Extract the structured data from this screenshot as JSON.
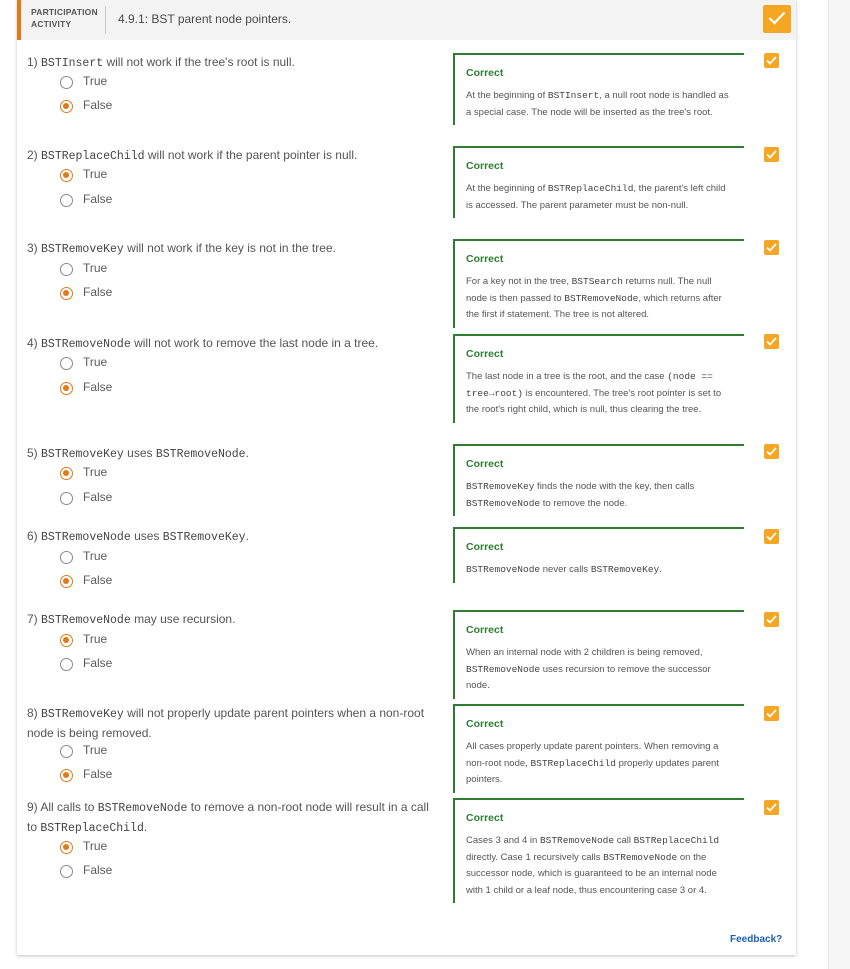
{
  "activity": {
    "label": "PARTICIPATION ACTIVITY",
    "title": "4.9.1: BST parent node pointers.",
    "complete_icon": "checkmark-icon",
    "feedback_link": "Feedback?"
  },
  "colors": {
    "accent": "#e07a17",
    "check": "#f5a623",
    "correct": "#2e7d32",
    "link": "#1a5fb4"
  },
  "questions": [
    {
      "number": "1)",
      "code": "BSTInsert",
      "text": " will not work if the tree's root is null.",
      "options": [
        "True",
        "False"
      ],
      "selected": "False",
      "status": "Correct",
      "feedback": [
        {
          "t": "At the beginning of "
        },
        {
          "c": "BSTInsert"
        },
        {
          "t": ", a null root node is handled as a special case. The node will be inserted as the tree's root."
        }
      ]
    },
    {
      "number": "2)",
      "code": "BSTReplaceChild",
      "text": " will not work if the parent pointer is null.",
      "options": [
        "True",
        "False"
      ],
      "selected": "True",
      "status": "Correct",
      "feedback": [
        {
          "t": "At the beginning of "
        },
        {
          "c": "BSTReplaceChild"
        },
        {
          "t": ", the parent's left child is accessed. The parent parameter must be non-null."
        }
      ]
    },
    {
      "number": "3)",
      "code": "BSTRemoveKey",
      "text": " will not work if the key is not in the tree.",
      "options": [
        "True",
        "False"
      ],
      "selected": "False",
      "status": "Correct",
      "feedback": [
        {
          "t": "For a key not in the tree, "
        },
        {
          "c": "BSTSearch"
        },
        {
          "t": " returns null. The null node is then passed to "
        },
        {
          "c": "BSTRemoveNode"
        },
        {
          "t": ", which returns after the first if statement. The tree is not altered."
        }
      ]
    },
    {
      "number": "4)",
      "code": "BSTRemoveNode",
      "text": " will not work to remove the last node in a tree.",
      "options": [
        "True",
        "False"
      ],
      "selected": "False",
      "status": "Correct",
      "feedback": [
        {
          "t": "The last node in a tree is the root, and the case "
        },
        {
          "c": "(node == tree→root)"
        },
        {
          "t": " is encountered. The tree's root pointer is set to the root's right child, which is null, thus clearing the tree."
        }
      ]
    },
    {
      "number": "5)",
      "code": "BSTRemoveKey",
      "text": " uses ",
      "code2": "BSTRemoveNode",
      "text2": ".",
      "options": [
        "True",
        "False"
      ],
      "selected": "True",
      "status": "Correct",
      "feedback": [
        {
          "c": "BSTRemoveKey"
        },
        {
          "t": " finds the node with the key, then calls "
        },
        {
          "c": "BSTRemoveNode"
        },
        {
          "t": " to remove the node."
        }
      ]
    },
    {
      "number": "6)",
      "code": "BSTRemoveNode",
      "text": " uses ",
      "code2": "BSTRemoveKey",
      "text2": ".",
      "options": [
        "True",
        "False"
      ],
      "selected": "False",
      "status": "Correct",
      "feedback": [
        {
          "c": "BSTRemoveNode"
        },
        {
          "t": " never calls "
        },
        {
          "c": "BSTRemoveKey"
        },
        {
          "t": "."
        }
      ]
    },
    {
      "number": "7)",
      "code": "BSTRemoveNode",
      "text": " may use recursion.",
      "options": [
        "True",
        "False"
      ],
      "selected": "True",
      "status": "Correct",
      "feedback": [
        {
          "t": "When an internal node with 2 children is being removed, "
        },
        {
          "c": "BSTRemoveNode"
        },
        {
          "t": " uses recursion to remove the successor node."
        }
      ]
    },
    {
      "number": "8)",
      "code": "BSTRemoveKey",
      "text": " will not properly update parent pointers when a non-root node is being removed.",
      "options": [
        "True",
        "False"
      ],
      "selected": "False",
      "status": "Correct",
      "feedback": [
        {
          "t": "All cases properly update parent pointers. When removing a non-root node, "
        },
        {
          "c": "BSTReplaceChild"
        },
        {
          "t": " properly updates parent pointers."
        }
      ]
    },
    {
      "number": "9)",
      "pre": "All calls to ",
      "code": "BSTRemoveNode",
      "text": " to remove a non-root node will result in a call to ",
      "code2": "BSTReplaceChild",
      "text2": ".",
      "options": [
        "True",
        "False"
      ],
      "selected": "True",
      "status": "Correct",
      "feedback": [
        {
          "t": "Cases 3 and 4 in "
        },
        {
          "c": "BSTRemoveNode"
        },
        {
          "t": " call "
        },
        {
          "c": "BSTReplaceChild"
        },
        {
          "t": " directly. Case 1 recursively calls "
        },
        {
          "c": "BSTRemoveNode"
        },
        {
          "t": " on the successor node, which is guaranteed to be an internal node with 1 child or a leaf node, thus encountering case 3 or 4."
        }
      ]
    }
  ]
}
